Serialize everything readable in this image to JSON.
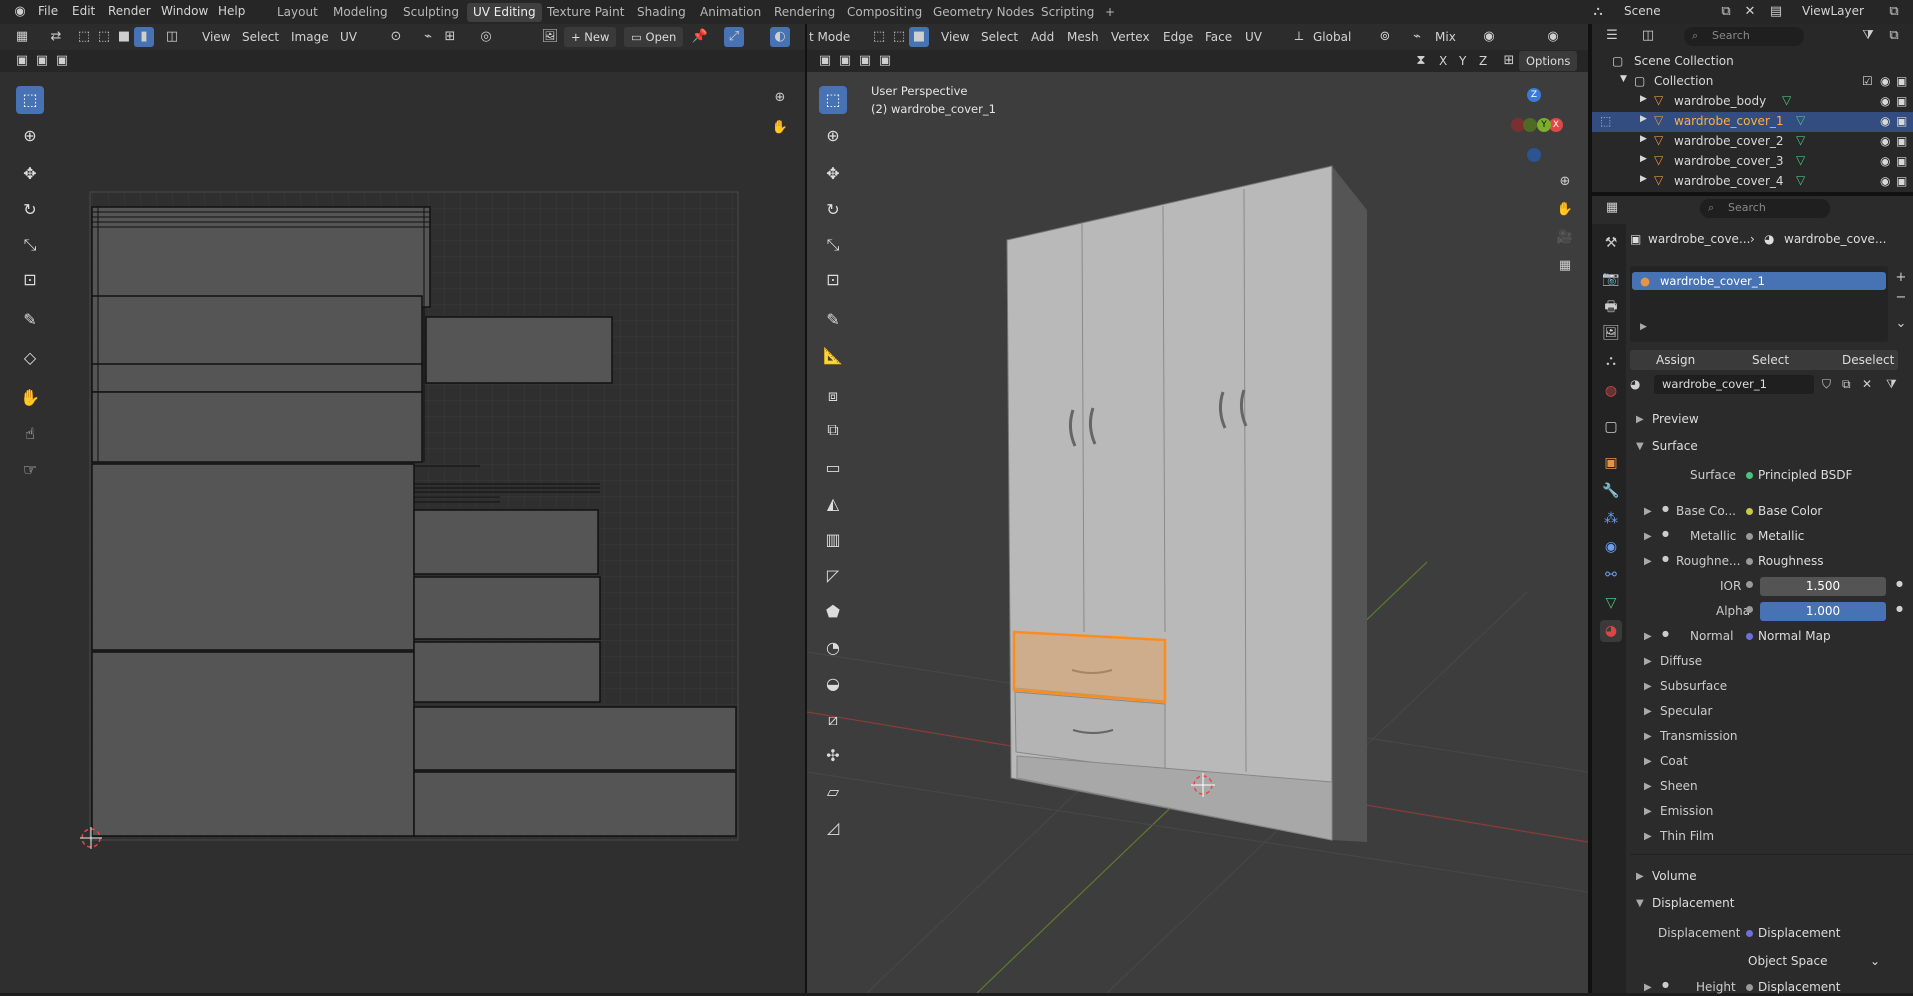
{
  "topbar": {
    "menus": [
      "File",
      "Edit",
      "Render",
      "Window",
      "Help"
    ],
    "workspaces": [
      "Layout",
      "Modeling",
      "Sculpting",
      "UV Editing",
      "Texture Paint",
      "Shading",
      "Animation",
      "Rendering",
      "Compositing",
      "Geometry Nodes",
      "Scripting"
    ],
    "active_workspace": "UV Editing",
    "add_tab": "+",
    "scene_name": "Scene",
    "view_layer": "ViewLayer"
  },
  "uv_editor": {
    "menus": [
      "View",
      "Select",
      "Image",
      "UV"
    ],
    "new_label": "New",
    "open_label": "Open"
  },
  "viewport": {
    "mode_label": "t Mode",
    "menus": [
      "View",
      "Select",
      "Add",
      "Mesh",
      "Vertex",
      "Edge",
      "Face",
      "UV"
    ],
    "orientation": "Global",
    "snap_label": "Mix",
    "options_label": "Options",
    "axes": [
      "X",
      "Y",
      "Z"
    ],
    "perspective_label": "User Perspective",
    "object_label": "(2) wardrobe_cover_1",
    "gizmo": {
      "z": "Z",
      "x": "X",
      "y": "Y"
    }
  },
  "outliner": {
    "search_placeholder": "Search",
    "scene_collection": "Scene Collection",
    "collection": "Collection",
    "objects": [
      "wardrobe_body",
      "wardrobe_cover_1",
      "wardrobe_cover_2",
      "wardrobe_cover_3",
      "wardrobe_cover_4"
    ],
    "selected_index": 1
  },
  "properties": {
    "search_placeholder": "Search",
    "breadcrumb_object": "wardrobe_cove...",
    "breadcrumb_material": "wardrobe_cove...",
    "slot_name": "wardrobe_cover_1",
    "assign": "Assign",
    "select": "Select",
    "deselect": "Deselect",
    "material_name": "wardrobe_cover_1",
    "preview": "Preview",
    "surface_panel": "Surface",
    "surface_label": "Surface",
    "surface_value": "Principled BSDF",
    "inputs": [
      {
        "label": "Base Co...",
        "value": "Base Color"
      },
      {
        "label": "Metallic",
        "value": "Metallic"
      },
      {
        "label": "Roughne...",
        "value": "Roughness"
      }
    ],
    "ior_label": "IOR",
    "ior_value": "1.500",
    "alpha_label": "Alpha",
    "alpha_value": "1.000",
    "normal_label": "Normal",
    "normal_value": "Normal Map",
    "subpanels": [
      "Diffuse",
      "Subsurface",
      "Specular",
      "Transmission",
      "Coat",
      "Sheen",
      "Emission",
      "Thin Film"
    ],
    "volume": "Volume",
    "displacement_panel": "Displacement",
    "displacement_label": "Displacement",
    "displacement_value": "Displacement",
    "space_value": "Object Space",
    "height_label": "Height",
    "height_value": "Displacement"
  }
}
